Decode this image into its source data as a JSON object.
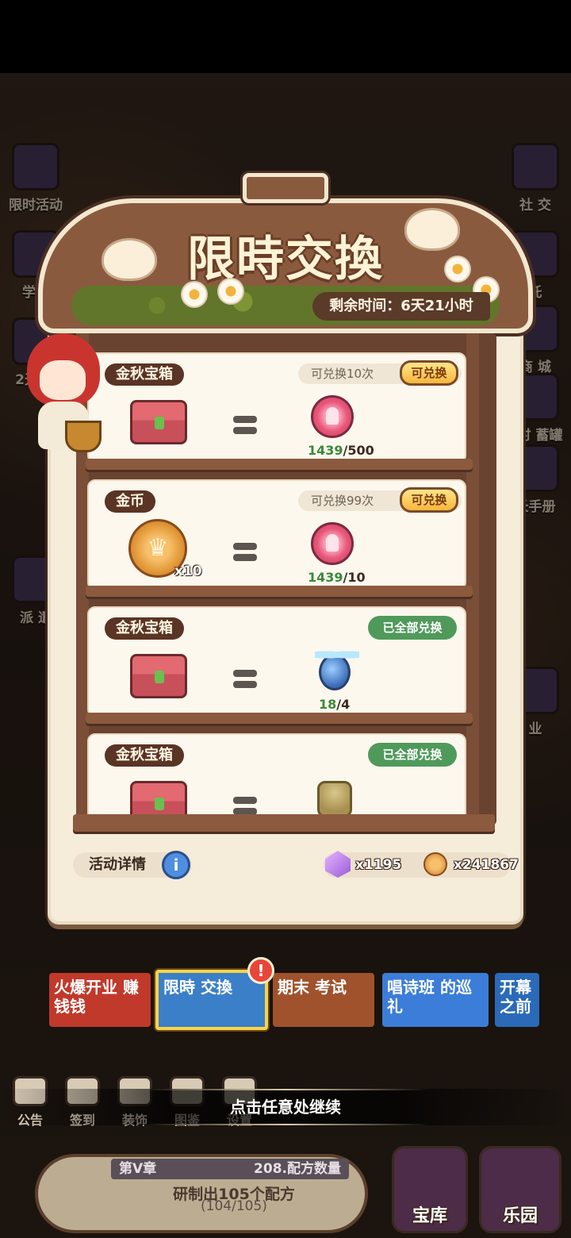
{
  "popup": {
    "title": "限時交換",
    "timer": "剩余时间：6天21小时",
    "details_label": "活动详情",
    "resources": [
      {
        "icon": "gem-icon",
        "amount": "x1195"
      },
      {
        "icon": "coin-icon",
        "amount": "x241867"
      }
    ],
    "exchange_button_label": "可兑换",
    "done_label": "已全部兑换",
    "items": [
      {
        "name": "金秋宝箱",
        "limit": "可兑换10次",
        "status": "available",
        "give_icon": "chest-icon",
        "give_qty": "",
        "get_icon": "pink-token-icon",
        "have": "1439",
        "need": "/500"
      },
      {
        "name": "金币",
        "limit": "可兑换99次",
        "status": "available",
        "give_icon": "gold-coin-icon",
        "give_qty": "x10",
        "get_icon": "pink-token-icon",
        "have": "1439",
        "need": "/10"
      },
      {
        "name": "金秋宝箱",
        "limit": "",
        "status": "done",
        "give_icon": "chest-icon",
        "give_qty": "",
        "get_icon": "blue-berry-icon",
        "have": "18",
        "need": "/4"
      },
      {
        "name": "金秋宝箱",
        "limit": "",
        "status": "done",
        "give_icon": "chest-icon",
        "give_qty": "",
        "get_icon": "seed-bundle-icon",
        "have": "",
        "need": ""
      }
    ]
  },
  "side_left": [
    "限时活动",
    "学期",
    "2天 轮",
    "派 遣"
  ],
  "side_right": [
    "社 交",
    "托",
    "商 城",
    "5时 蓄罐",
    "长手册",
    "业"
  ],
  "banners": [
    {
      "text": "火爆开业 赚钱钱",
      "color": "#c0392b"
    },
    {
      "text": "限時 交換",
      "color": "#3a7fc8"
    },
    {
      "text": "期末 考试",
      "color": "#a0522d"
    },
    {
      "text": "唱诗班 的巡礼",
      "color": "#3b7dd8"
    },
    {
      "text": "开幕 之前",
      "color": "#2a6ab8"
    }
  ],
  "alert_badge": "!",
  "continue_hint": "点击任意处继续",
  "dock": [
    "公告",
    "签到",
    "装饰",
    "图鉴",
    "设置"
  ],
  "chapter": {
    "label": "第V章",
    "recipes": "208.配方数量",
    "goal": "研制出105个配方",
    "progress": "(104/105)"
  },
  "corner_buttons": [
    "宝库",
    "乐园"
  ]
}
